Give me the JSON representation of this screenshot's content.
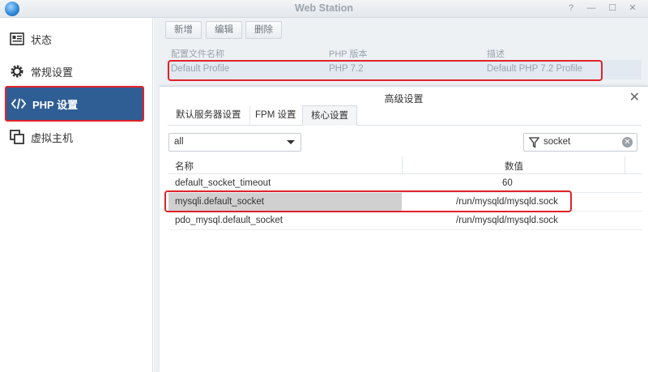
{
  "window": {
    "title": "Web Station",
    "controls": [
      "?",
      "—",
      "☐",
      "✕"
    ]
  },
  "sidebar": {
    "items": [
      {
        "label": "状态",
        "icon": "status-card-icon",
        "active": false
      },
      {
        "label": "常规设置",
        "icon": "gear-icon",
        "active": false
      },
      {
        "label": "PHP 设置",
        "icon": "code-icon",
        "active": true
      },
      {
        "label": "虚拟主机",
        "icon": "virtual-host-icon",
        "active": false
      }
    ]
  },
  "toolbar": {
    "create_label": "新增",
    "edit_label": "编辑",
    "delete_label": "删除"
  },
  "profiles": {
    "columns": [
      "配置文件名称",
      "PHP 版本",
      "描述"
    ],
    "rows": [
      {
        "name": "Default Profile",
        "version": "PHP 7.2",
        "description": "Default PHP 7.2 Profile"
      }
    ]
  },
  "modal": {
    "title": "高级设置",
    "tabs": [
      "默认服务器设置",
      "FPM 设置",
      "核心设置"
    ],
    "active_tab": "核心设置",
    "filter_select": "all",
    "search_value": "socket",
    "columns": [
      "名称",
      "数值"
    ],
    "rows": [
      {
        "name": "default_socket_timeout",
        "value": "60"
      },
      {
        "name": "mysqli.default_socket",
        "value": "/run/mysqld/mysqld.sock"
      },
      {
        "name": "pdo_mysql.default_socket",
        "value": "/run/mysqld/mysqld.sock"
      }
    ]
  },
  "colors": {
    "accent": "#2f5e94",
    "highlight": "#e0232a",
    "selected_row": "#e2e9f1"
  }
}
